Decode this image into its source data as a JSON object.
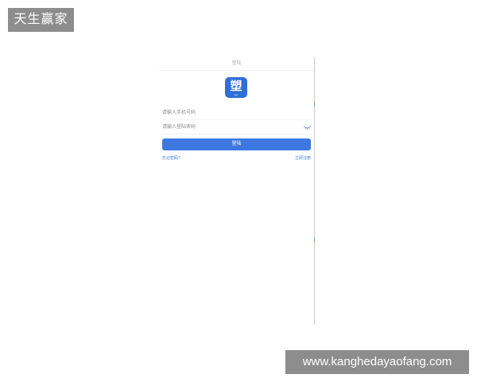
{
  "watermarks": {
    "top_left": "天生赢家",
    "bottom_right": "www.kanghedayaofang.com"
  },
  "header": {
    "title": "登陆"
  },
  "logo": {
    "glyph": "塑",
    "caption": "logo"
  },
  "form": {
    "phone_placeholder": "请输入手机号码",
    "password_placeholder": "请输入登陆密码",
    "password_toggle_icon": "eye-closed-icon",
    "login_label": "登陆"
  },
  "links": {
    "forgot_password": "忘记密码?",
    "register": "立即注册"
  },
  "colors": {
    "accent": "#3c78e0",
    "logo_background": "#2f6fd6",
    "watermark_background": "#8d8d8d"
  }
}
